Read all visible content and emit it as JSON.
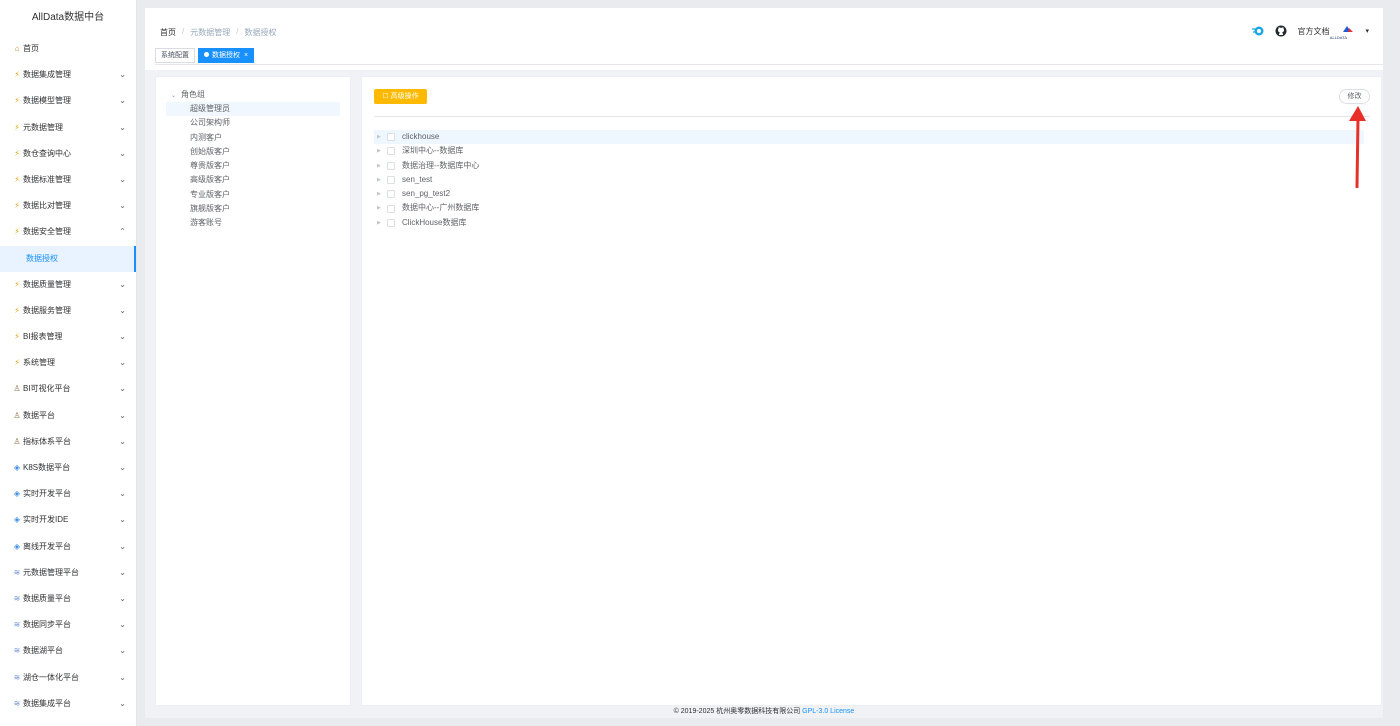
{
  "app": {
    "title": "AllData数据中台"
  },
  "sidebar": {
    "items": [
      {
        "label": "首页",
        "icon": "home-icon",
        "chevron": false
      },
      {
        "label": "数据集成管理",
        "icon": "lightning-icon",
        "chevron": true
      },
      {
        "label": "数据模型管理",
        "icon": "lightning-icon",
        "chevron": true
      },
      {
        "label": "元数据管理",
        "icon": "lightning-icon",
        "chevron": true
      },
      {
        "label": "数仓查询中心",
        "icon": "lightning-icon",
        "chevron": true
      },
      {
        "label": "数据标准管理",
        "icon": "lightning-icon",
        "chevron": true
      },
      {
        "label": "数据比对管理",
        "icon": "lightning-icon",
        "chevron": true
      },
      {
        "label": "数据安全管理",
        "icon": "lightning-icon",
        "chevron": true,
        "expanded": true
      },
      {
        "label": "数据授权",
        "icon": "",
        "chevron": false,
        "sub": true,
        "active": true
      },
      {
        "label": "数据质量管理",
        "icon": "lightning-icon",
        "chevron": true
      },
      {
        "label": "数据服务管理",
        "icon": "lightning-icon",
        "chevron": true
      },
      {
        "label": "BI报表管理",
        "icon": "lightning-icon",
        "chevron": true
      },
      {
        "label": "系统管理",
        "icon": "lightning-icon",
        "chevron": true
      },
      {
        "label": "BI可视化平台",
        "icon": "person-icon",
        "chevron": true
      },
      {
        "label": "数据平台",
        "icon": "person-icon",
        "chevron": true
      },
      {
        "label": "指标体系平台",
        "icon": "person-icon",
        "chevron": true
      },
      {
        "label": "K8S数据平台",
        "icon": "globe-icon",
        "chevron": true
      },
      {
        "label": "实时开发平台",
        "icon": "globe-icon",
        "chevron": true
      },
      {
        "label": "实时开发IDE",
        "icon": "globe-icon",
        "chevron": true
      },
      {
        "label": "离线开发平台",
        "icon": "globe-icon",
        "chevron": true
      },
      {
        "label": "元数据管理平台",
        "icon": "layers-icon",
        "chevron": true
      },
      {
        "label": "数据质量平台",
        "icon": "layers-icon",
        "chevron": true
      },
      {
        "label": "数据同步平台",
        "icon": "layers-icon",
        "chevron": true
      },
      {
        "label": "数据湖平台",
        "icon": "layers-icon",
        "chevron": true
      },
      {
        "label": "湖仓一体化平台",
        "icon": "layers-icon",
        "chevron": true
      },
      {
        "label": "数据集成平台",
        "icon": "layers-icon",
        "chevron": true
      }
    ]
  },
  "breadcrumb": {
    "home": "首页",
    "level1": "元数据管理",
    "level2": "数据授权",
    "sep": "/"
  },
  "navbar": {
    "docs": "官方文档",
    "avatar_text": "ALLDATA"
  },
  "tags": {
    "tab1": "系统配置",
    "tab2": "数据授权",
    "close": "×"
  },
  "roles": {
    "root": "角色组",
    "items": [
      "超级管理员",
      "公司架构师",
      "内测客户",
      "创始版客户",
      "尊贵版客户",
      "高级版客户",
      "专业版客户",
      "旗舰版客户",
      "游客账号"
    ]
  },
  "toolbar": {
    "advanced": "高级操作",
    "edit": "修改"
  },
  "databases": [
    "clickhouse",
    "深圳中心--数据库",
    "数据治理--数据库中心",
    "sen_test",
    "sen_pg_test2",
    "数据中心--广州数据库",
    "ClickHouse数据库"
  ],
  "footer": {
    "copyright": "© 2019-2025 杭州奥零数据科技有限公司",
    "license": "GPL-3.0 License"
  },
  "colors": {
    "accent": "#1890ff",
    "warning": "#ffba00",
    "annotation": "#e8302a"
  }
}
